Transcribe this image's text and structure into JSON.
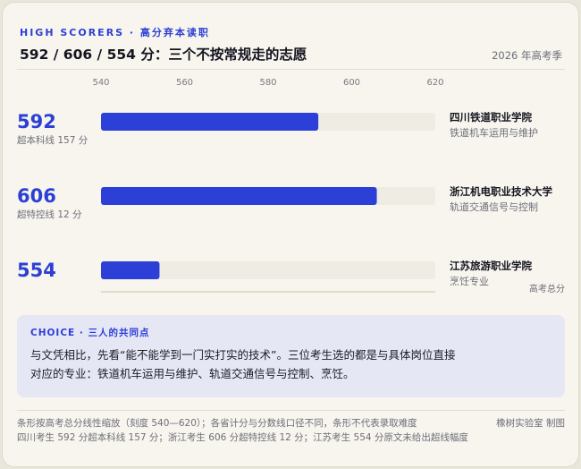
{
  "header": {
    "kicker": "HIGH SCORERS · 高分弃本读职",
    "title": "592 / 606 / 554 分：三个不按常规走的志愿",
    "season": "2026 年高考季"
  },
  "chart_data": {
    "type": "bar",
    "orientation": "horizontal",
    "xlim": [
      540,
      620
    ],
    "ticks": [
      540,
      560,
      580,
      600,
      620
    ],
    "xlabel": "高考总分",
    "categories": [
      "四川铁道职业学院",
      "浙江机电职业技术大学",
      "江苏旅游职业学院"
    ],
    "values": [
      592,
      606,
      554
    ],
    "rows": [
      {
        "score": "592",
        "note": "超本科线 157 分",
        "school": "四川铁道职业学院",
        "major": "铁道机车运用与维护"
      },
      {
        "score": "606",
        "note": "超特控线 12 分",
        "school": "浙江机电职业技术大学",
        "major": "轨道交通信号与控制"
      },
      {
        "score": "554",
        "note": "",
        "school": "江苏旅游职业学院",
        "major": "烹饪专业"
      }
    ],
    "bar_color": "#2c3fd6",
    "track_color": "#efece3"
  },
  "choice": {
    "heading": "CHOICE · 三人的共同点",
    "line1": "与文凭相比，先看“能不能学到一门实打实的技术”。三位考生选的都是与具体岗位直接",
    "line2": "对应的专业：铁道机车运用与维护、轨道交通信号与控制、烹饪。"
  },
  "footer": {
    "note1": "条形按高考总分线性缩放（刻度 540—620）；各省计分与分数线口径不同，条形不代表录取难度",
    "note2": "四川考生 592 分超本科线 157 分；浙江考生 606 分超特控线 12 分；江苏考生 554 分原文未给出超线幅度",
    "credit": "橡树实验室 制图"
  }
}
